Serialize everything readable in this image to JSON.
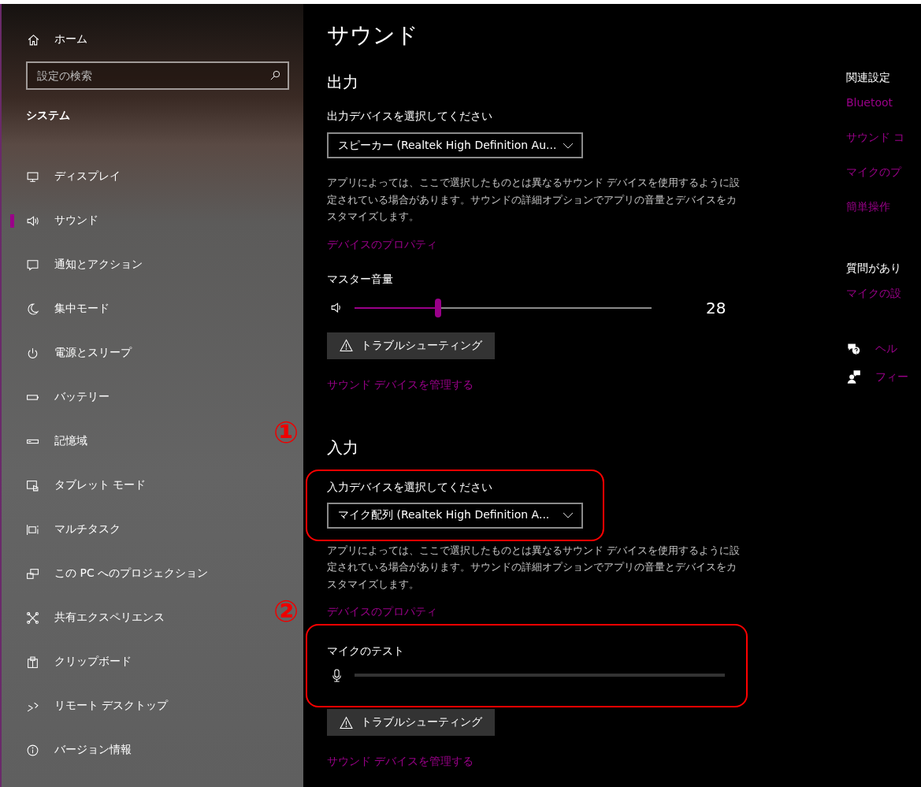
{
  "sidebar": {
    "home": "ホーム",
    "search": {
      "placeholder": "設定の検索"
    },
    "category": "システム",
    "items": [
      {
        "label": "ディスプレイ",
        "selected": false
      },
      {
        "label": "サウンド",
        "selected": true
      },
      {
        "label": "通知とアクション",
        "selected": false
      },
      {
        "label": "集中モード",
        "selected": false
      },
      {
        "label": "電源とスリープ",
        "selected": false
      },
      {
        "label": "バッテリー",
        "selected": false
      },
      {
        "label": "記憶域",
        "selected": false
      },
      {
        "label": "タブレット モード",
        "selected": false
      },
      {
        "label": "マルチタスク",
        "selected": false
      },
      {
        "label": "この PC へのプロジェクション",
        "selected": false
      },
      {
        "label": "共有エクスペリエンス",
        "selected": false
      },
      {
        "label": "クリップボード",
        "selected": false
      },
      {
        "label": "リモート デスクトップ",
        "selected": false
      },
      {
        "label": "バージョン情報",
        "selected": false
      }
    ]
  },
  "main": {
    "title": "サウンド",
    "output": {
      "heading": "出力",
      "device_label": "出力デバイスを選択してください",
      "device": "スピーカー (Realtek High Definition Au...",
      "note": "アプリによっては、ここで選択したものとは異なるサウンド デバイスを使用するように設定されている場合があります。サウンドの詳細オプションでアプリの音量とデバイスをカスタマイズします。",
      "properties_link": "デバイスのプロパティ",
      "volume_label": "マスター音量",
      "volume": {
        "level": 0.28
      },
      "volume_reading": "28",
      "troubleshoot": "トラブルシューティング",
      "manage_link": "サウンド デバイスを管理する"
    },
    "input": {
      "marker": "①",
      "heading": "入力",
      "device_highlighted": true,
      "device_label": "入力デバイスを選択してください",
      "device": "マイク配列 (Realtek High Definition A...",
      "note": "アプリによっては、ここで選択したものとは異なるサウンド デバイスを使用するように設定されている場合があります。サウンドの詳細オプションでアプリの音量とデバイスをカスタマイズします。",
      "properties_link": "デバイスのプロパティ",
      "mic_test": {
        "marker": "②",
        "highlighted": true,
        "label": "マイクのテスト",
        "level": 0
      },
      "troubleshoot": "トラブルシューティング",
      "manage_link": "サウンド デバイスを管理する"
    }
  },
  "related": {
    "heading": "関連設定",
    "links": [
      "Bluetoot",
      "サウンド コ",
      "マイクのプ",
      "簡単操作"
    ],
    "question_heading": "質問があり",
    "question_link": "マイクの設",
    "help_links": [
      "ヘル",
      "フィー"
    ]
  }
}
